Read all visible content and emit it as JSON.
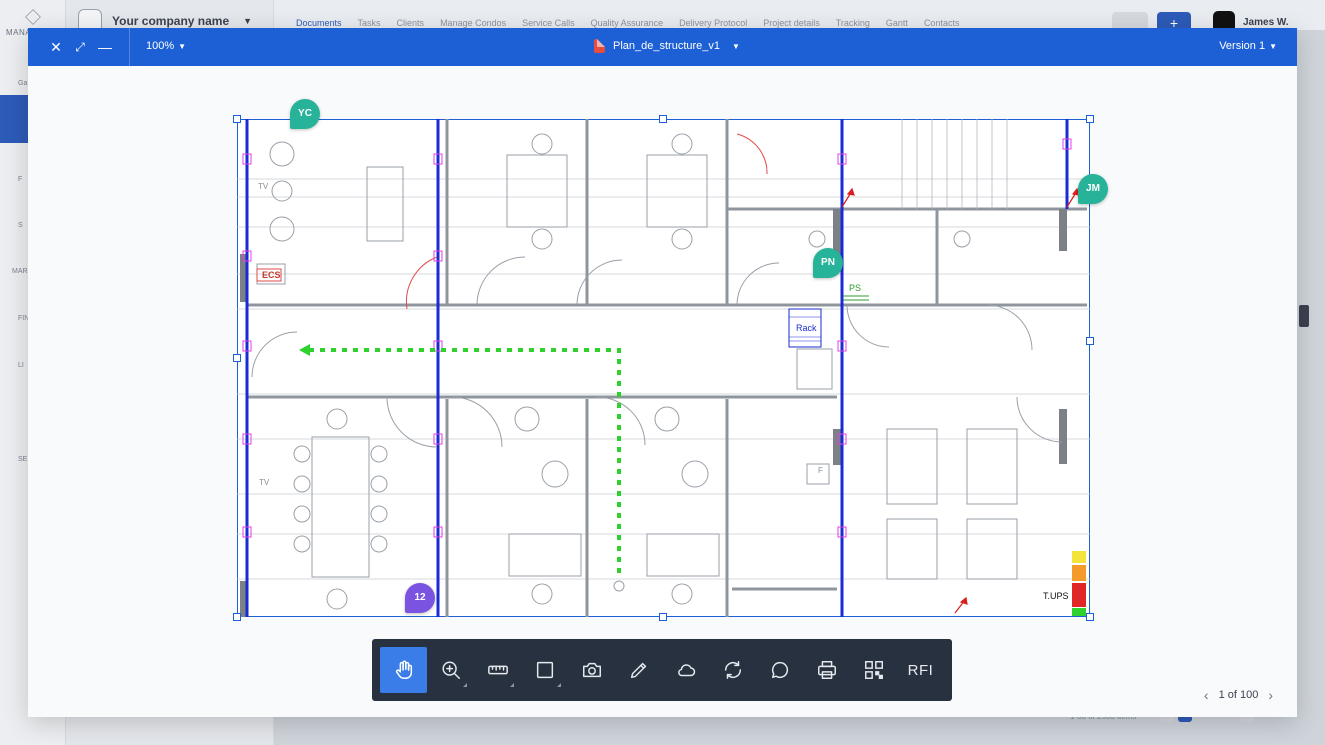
{
  "background_app": {
    "sidebar_label": "MANA",
    "sidebar_fragments": [
      "Ga",
      "F",
      "S",
      "MAR",
      "FIN",
      "LI",
      "SE"
    ],
    "company_name": "Your company name",
    "tabs": [
      "Documents",
      "Tasks",
      "Clients",
      "Manage Condos",
      "Service Calls",
      "Quality Assurance",
      "Delivery Protocol",
      "Project details",
      "Tracking",
      "Gantt",
      "Contacts"
    ],
    "active_tab": "Documents",
    "add_label": "+",
    "user_name": "James W.",
    "footer_items": "1-30 of 2530 items"
  },
  "viewer": {
    "zoom": "100%",
    "file_name": "Plan_de_structure_v1",
    "version": "Version 1",
    "pager": {
      "text": "1 of 100"
    }
  },
  "plan": {
    "labels": {
      "ecs": "ECS",
      "rack": "Rack",
      "ps": "PS",
      "tv1": "TV",
      "tv2": "TV",
      "tups": "T.UPS",
      "f": "F"
    },
    "pins": [
      {
        "initials": "YC",
        "color": "#26b39a"
      },
      {
        "initials": "JM",
        "color": "#26b39a"
      },
      {
        "initials": "PN",
        "color": "#26b39a"
      },
      {
        "initials": "12",
        "color": "#7a54e0"
      }
    ]
  },
  "toolbar": {
    "tools": [
      "pan-hand",
      "zoom",
      "measure",
      "rectangle",
      "camera",
      "pencil",
      "cloud",
      "refresh",
      "comment",
      "print",
      "qr-code",
      "rfi"
    ],
    "rfi_label": "RFI",
    "active_tool": "pan-hand"
  },
  "colors": {
    "header_blue": "#1d5fd4",
    "toolbar_dark": "#27313f",
    "active_tool": "#3a7de8",
    "pin_green": "#26b39a",
    "pin_purple": "#7a54e0",
    "route_green": "#2ed12e",
    "wall_blue": "#1a2bd6"
  }
}
